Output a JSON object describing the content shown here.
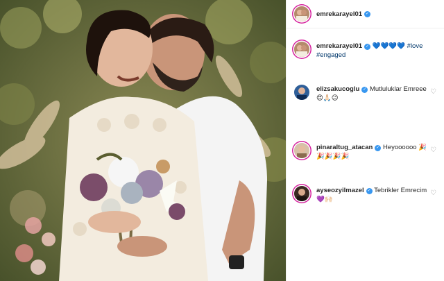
{
  "post": {
    "author": "emrekarayel01",
    "caption_hearts": "💙💙💙💙",
    "caption_tags": [
      "#love",
      "#engaged"
    ]
  },
  "comments": [
    {
      "user": "elizsakucoglu",
      "verified": true,
      "text": "Mutluluklar Emreee 😍🙏🏻😉"
    },
    {
      "user": "pinaraltug_atacan",
      "verified": true,
      "text": "Heyoooooo 🎉🎉🎉🎉🎉"
    },
    {
      "user": "ayseozyilmazel",
      "verified": true,
      "text": "Tebrikler Emrecim 💜🙌🏻"
    }
  ],
  "icons": {
    "verified": "verified-badge-icon",
    "like": "heart-outline-icon"
  },
  "colors": {
    "verified_blue": "#3897f0",
    "hashtag": "#00376b",
    "text": "#262626",
    "muted": "#8e8e8e"
  }
}
